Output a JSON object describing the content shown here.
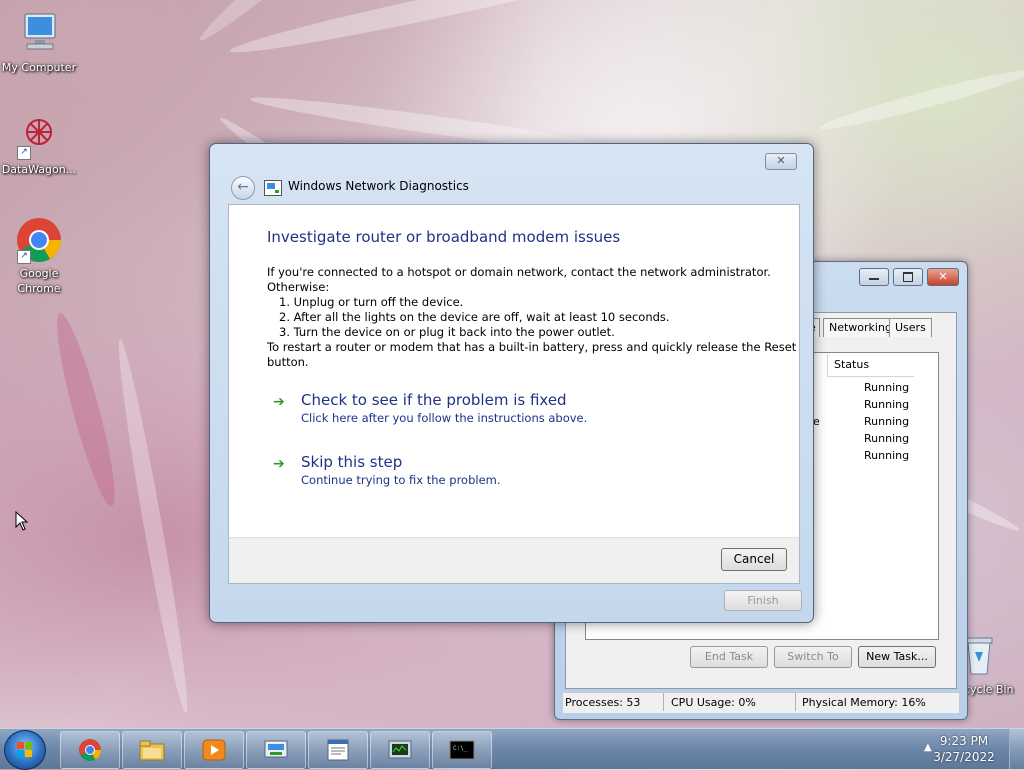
{
  "desktop": {
    "icons": [
      {
        "label": "My Computer",
        "icon": "computer-icon"
      },
      {
        "label": "DataWagon...",
        "icon": "datawagon-icon"
      },
      {
        "label": "Google Chrome",
        "icon": "chrome-icon"
      },
      {
        "label": "cycle Bin",
        "icon": "recycle-bin-icon"
      }
    ]
  },
  "task_manager": {
    "tabs": [
      "e",
      "Networking",
      "Users"
    ],
    "column_status": "Status",
    "partial_text": "e",
    "rows": [
      "Running",
      "Running",
      "Running",
      "Running",
      "Running"
    ],
    "buttons": {
      "end_task": "End Task",
      "switch_to": "Switch To",
      "new_task": "New Task..."
    },
    "statusbar": {
      "processes": "Processes: 53",
      "cpu": "CPU Usage: 0%",
      "memory": "Physical Memory: 16%"
    }
  },
  "diagnostics": {
    "window_title": "Windows Network Diagnostics",
    "close_glyph": "✕",
    "heading": "Investigate router or broadband modem issues",
    "intro_line1": "If you're connected to a hotspot or domain network, contact the network administrator.",
    "intro_line2": "Otherwise:",
    "steps": [
      "1.  Unplug or turn off the device.",
      "2.  After all the lights on the device are off, wait at least 10 seconds.",
      "3.  Turn the device on or plug it back into the power outlet."
    ],
    "restart_line1": "To restart a router or modem that has a built-in battery, press and quickly release the Reset",
    "restart_line2": "button.",
    "options": [
      {
        "title": "Check to see if the problem is fixed",
        "subtitle": "Click here after you follow the instructions above."
      },
      {
        "title": "Skip this step",
        "subtitle": "Continue trying to fix the problem."
      }
    ],
    "cancel_label": "Cancel",
    "finish_label": "Finish"
  },
  "taskbar": {
    "clock_time": "9:23 PM",
    "clock_date": "3/27/2022",
    "pinned": [
      "chrome-icon",
      "explorer-icon",
      "media-player-icon",
      "network-icon",
      "document-icon",
      "task-manager-icon",
      "cmd-icon"
    ]
  },
  "colors": {
    "link_blue": "#1e3287",
    "arrow_green": "#2b9b2b",
    "taskbar": "#6c86a8"
  }
}
